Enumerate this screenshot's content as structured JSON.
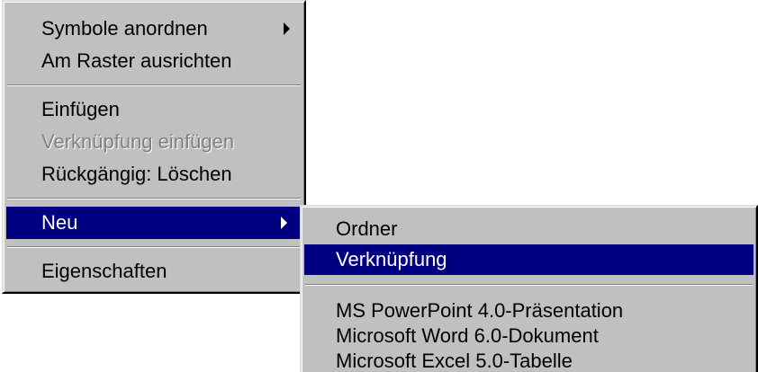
{
  "main_menu": {
    "items": [
      {
        "label": "Symbole anordnen",
        "has_submenu": true
      },
      {
        "label": "Am Raster ausrichten"
      },
      {
        "label": "Einfügen"
      },
      {
        "label": "Verknüpfung einfügen",
        "disabled": true
      },
      {
        "label": "Rückgängig: Löschen"
      },
      {
        "label": "Neu",
        "has_submenu": true,
        "selected": true
      },
      {
        "label": "Eigenschaften"
      }
    ]
  },
  "sub_menu": {
    "items": [
      {
        "label": "Ordner"
      },
      {
        "label": "Verknüpfung",
        "selected": true
      },
      {
        "label": "MS PowerPoint 4.0-Präsentation"
      },
      {
        "label": "Microsoft Word 6.0-Dokument"
      },
      {
        "label": "Microsoft Excel 5.0-Tabelle"
      }
    ]
  },
  "colors": {
    "menu_bg": "#c0c0c0",
    "selection_bg": "#000080",
    "selection_text": "#ffffff",
    "disabled_text": "#808080"
  },
  "icons": {
    "submenu_arrow": "chevron-right-icon"
  }
}
